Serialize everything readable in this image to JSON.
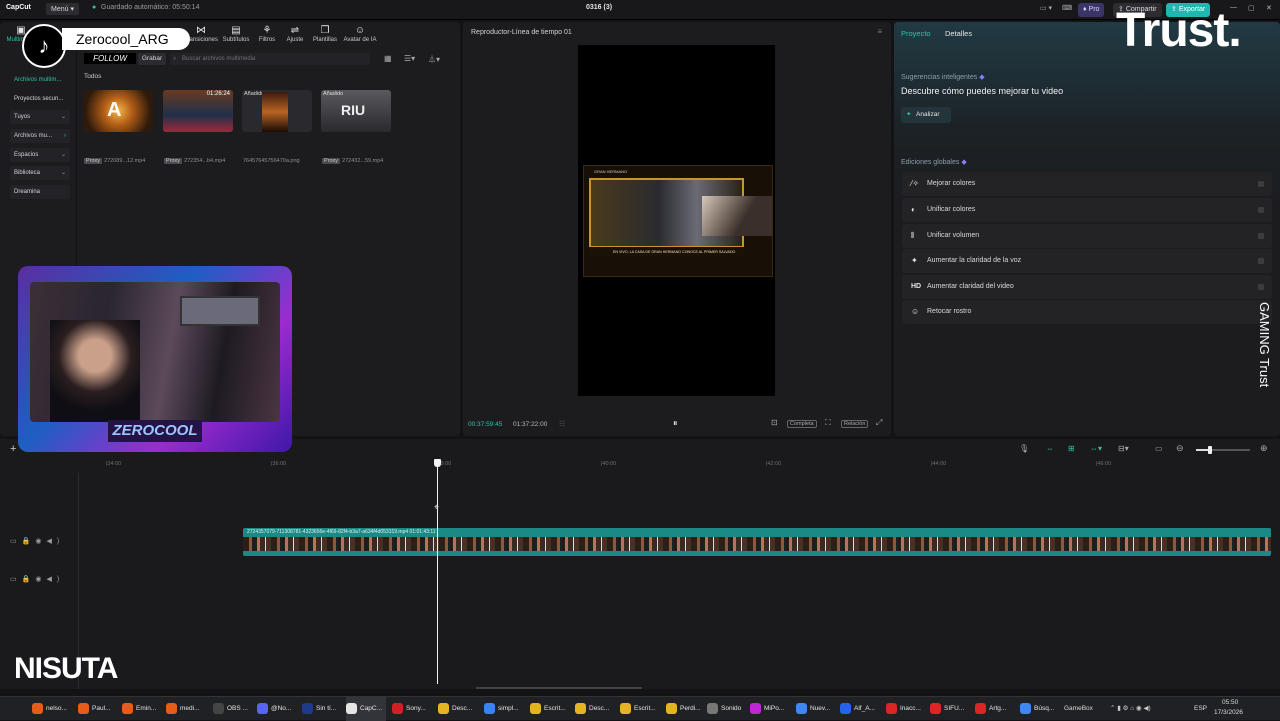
{
  "app": {
    "name": "CapCut",
    "menu_label": "Menú",
    "autosave": "Guardado automático: 05:50:14",
    "project_title": "0316 (3)",
    "pro_label": "Pro",
    "share_label": "Compartir",
    "export_label": "Exportar"
  },
  "overlay": {
    "tiktok_user": "Zerocool_ARG",
    "follow": "FOLLOW",
    "trust_logo": "Trust.",
    "gaming_trust": "GAMING Trust",
    "webcam_name": "ZEROCOOL",
    "nisuta_logo": "NISUTA"
  },
  "media": {
    "tools": [
      {
        "icon": "media-icon",
        "label": "Multimedia"
      },
      {
        "icon": "transitions-icon",
        "label": "Transiciones"
      },
      {
        "icon": "subtitles-icon",
        "label": "Subtítulos"
      },
      {
        "icon": "filters-icon",
        "label": "Filtros"
      },
      {
        "icon": "adjust-icon",
        "label": "Ajuste"
      },
      {
        "icon": "templates-icon",
        "label": "Plantillas"
      },
      {
        "icon": "ai-avatar-icon",
        "label": "Avatar de IA"
      }
    ],
    "record_label": "Grabar",
    "search_placeholder": "Buscar archivos multimedia",
    "filter_all": "Todos",
    "sidebar": [
      {
        "label": "Archivos multim..."
      },
      {
        "label": "Proyectos secun..."
      },
      {
        "label": "Tuyos"
      },
      {
        "label": "Archivos mu..."
      },
      {
        "label": "Espacios"
      },
      {
        "label": "Biblioteca"
      },
      {
        "label": "Dreamina"
      }
    ],
    "items": [
      {
        "name": "272089...12.mp4",
        "proxy": "Proxy",
        "badge": "",
        "duration": ""
      },
      {
        "name": "272354...b4.mp4",
        "proxy": "Proxy",
        "badge": "",
        "duration": "01:26:24"
      },
      {
        "name": "76457645756470a.png",
        "proxy": "",
        "badge": "Añadido",
        "duration": ""
      },
      {
        "name": "272432...59.mp4",
        "proxy": "Proxy",
        "badge": "Añadido",
        "duration": ""
      }
    ]
  },
  "player": {
    "title": "Reproductor-Línea de tiempo 01",
    "current_time": "00:37:59:45",
    "total_time": "01:37:22:00",
    "ratio_label": "Completa",
    "quality_label": "Relación",
    "frame_caption": "EN VIVO, LA CASA DE GRAN HERMANO CONOCE AL PRIMER SALVADO",
    "frame_show": "GRAN HERMANO"
  },
  "props": {
    "tabs": [
      "Proyecto",
      "Detalles"
    ],
    "smart_heading": "Sugerencias inteligentes",
    "smart_text": "Descubre cómo puedes mejorar tu video",
    "analyze_label": "Analizar",
    "global_heading": "Ediciones globales",
    "edits": [
      {
        "icon": "magic-wand-icon",
        "label": "Mejorar colores"
      },
      {
        "icon": "color-match-icon",
        "label": "Unificar colores"
      },
      {
        "icon": "volume-levels-icon",
        "label": "Unificar volumen"
      },
      {
        "icon": "voice-clarity-icon",
        "label": "Aumentar la claridad de la voz"
      },
      {
        "icon": "hd-icon",
        "label": "Aumentar claridad del video"
      },
      {
        "icon": "face-retouch-icon",
        "label": "Retocar rostro"
      }
    ]
  },
  "timeline": {
    "ruler": [
      "|34:00",
      "|36:00",
      "|38:00",
      "|40:00",
      "|42:00",
      "|44:00",
      "|46:00"
    ],
    "clip_label": "2724357079-711308781-4323656e-4f69-82f4-b3a7-a634f4d053319.mp4   01:01:43:11"
  },
  "taskbar": {
    "items": [
      {
        "label": "nelso...",
        "color": "#e65c1b"
      },
      {
        "label": "Paul...",
        "color": "#e65c1b"
      },
      {
        "label": "Emin...",
        "color": "#e65c1b"
      },
      {
        "label": "medi...",
        "color": "#e65c1b"
      },
      {
        "label": "OBS ...",
        "color": "#444"
      },
      {
        "label": "@No...",
        "color": "#5865f2"
      },
      {
        "label": "Sin tí...",
        "color": "#1e3a8a"
      },
      {
        "label": "CapC...",
        "color": "#e5e5e5"
      },
      {
        "label": "Sony...",
        "color": "#d31f26"
      },
      {
        "label": "Desc...",
        "color": "#e6b422"
      },
      {
        "label": "simpl...",
        "color": "#3b82f6"
      },
      {
        "label": "Escrit...",
        "color": "#e6b422"
      },
      {
        "label": "Desc...",
        "color": "#e6b422"
      },
      {
        "label": "Escrit...",
        "color": "#e6b422"
      },
      {
        "label": "Perdi...",
        "color": "#e6b422"
      },
      {
        "label": "Sonido",
        "color": "#777"
      },
      {
        "label": "MiPo...",
        "color": "#c026d3"
      },
      {
        "label": "Nuev...",
        "color": "#4285f4"
      },
      {
        "label": "Alf_A...",
        "color": "#2563eb"
      },
      {
        "label": "Inacc...",
        "color": "#dc2626"
      },
      {
        "label": "SIFU...",
        "color": "#dc2626"
      },
      {
        "label": "Artg...",
        "color": "#dc2626"
      },
      {
        "label": "Búsq...",
        "color": "#4285f4"
      }
    ],
    "gamebox": "GameBox",
    "lang": "ESP",
    "time": "05:50",
    "date": "17/3/2026"
  }
}
